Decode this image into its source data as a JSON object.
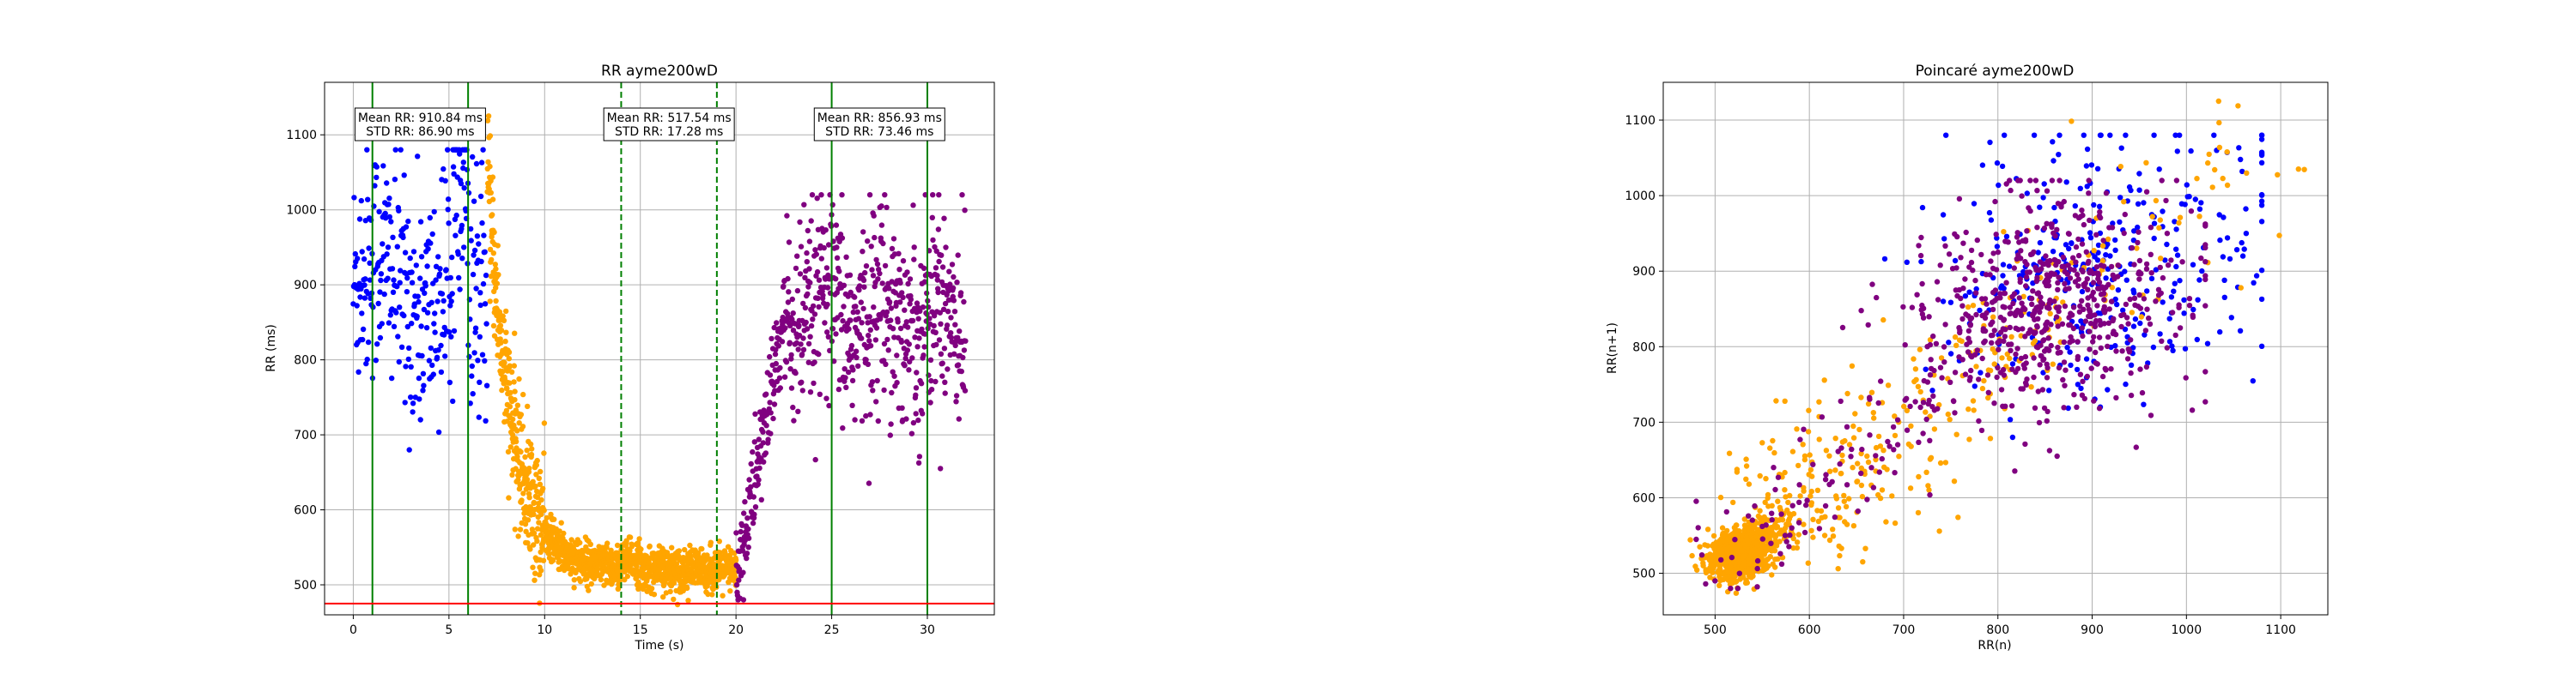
{
  "chart_data": [
    {
      "type": "scatter",
      "title": "RR ayme200wD",
      "xlabel": "Time (s)",
      "ylabel": "RR (ms)",
      "xlim": [
        -1.5,
        33.5
      ],
      "ylim": [
        460,
        1170
      ],
      "xticks": [
        0,
        5,
        10,
        15,
        20,
        25,
        30
      ],
      "yticks": [
        500,
        600,
        700,
        800,
        900,
        1000,
        1100
      ],
      "grid": true,
      "series_colors": {
        "seg1": "#0000ff",
        "seg2": "#ffa500",
        "seg3": "#800080"
      },
      "threshold_line": {
        "y": 475,
        "color": "#ff0000"
      },
      "vlines": [
        {
          "x": 1.0,
          "style": "solid",
          "color": "#008000"
        },
        {
          "x": 6.0,
          "style": "solid",
          "color": "#008000"
        },
        {
          "x": 14.0,
          "style": "dashed",
          "color": "#008000"
        },
        {
          "x": 19.0,
          "style": "dashed",
          "color": "#008000"
        },
        {
          "x": 25.0,
          "style": "solid",
          "color": "#008000"
        },
        {
          "x": 30.0,
          "style": "solid",
          "color": "#008000"
        }
      ],
      "annotations": [
        {
          "x": 3.5,
          "line1": "Mean RR: 910.84 ms",
          "line2": "STD RR: 86.90 ms"
        },
        {
          "x": 16.5,
          "line1": "Mean RR: 517.54 ms",
          "line2": "STD RR: 17.28 ms"
        },
        {
          "x": 27.5,
          "line1": "Mean RR: 856.93 ms",
          "line2": "STD RR: 73.46 ms"
        }
      ],
      "segments": [
        {
          "name": "seg1",
          "x_range": [
            0,
            7.0
          ],
          "mean": 900,
          "std": 82
        },
        {
          "name": "seg2",
          "x_range": [
            7.0,
            20.0
          ],
          "mean": 517.54,
          "std": 17.28,
          "trend": "decay 1050 to 520"
        },
        {
          "name": "seg3",
          "x_range": [
            20.0,
            32.0
          ],
          "mean": 856.93,
          "std": 73.46,
          "trend": "rise 500 to 850"
        }
      ]
    },
    {
      "type": "scatter",
      "title": "Poincaré ayme200wD",
      "xlabel": "RR(n)",
      "ylabel": "RR(n+1)",
      "xlim": [
        445,
        1150
      ],
      "ylim": [
        445,
        1150
      ],
      "xticks": [
        500,
        600,
        700,
        800,
        900,
        1000,
        1100
      ],
      "yticks": [
        500,
        600,
        700,
        800,
        900,
        1000,
        1100
      ],
      "grid": true,
      "series_colors": {
        "seg1": "#0000ff",
        "seg2": "#ffa500",
        "seg3": "#800080"
      }
    }
  ]
}
